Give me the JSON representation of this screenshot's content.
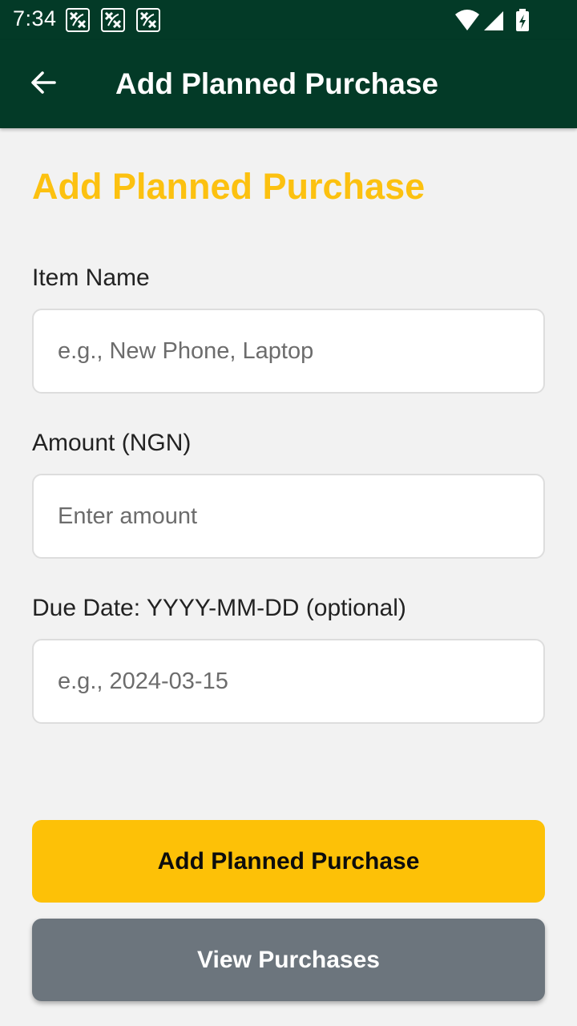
{
  "status_bar": {
    "time": "7:34",
    "notification_icons": [
      "app-notification-icon",
      "app-notification-icon",
      "app-notification-icon"
    ],
    "right_icons": [
      "wifi-icon",
      "cellular-signal-icon",
      "battery-charging-icon"
    ]
  },
  "app_bar": {
    "back_icon": "arrow-left-icon",
    "title": "Add Planned Purchase"
  },
  "page": {
    "heading": "Add Planned Purchase"
  },
  "form": {
    "item_name": {
      "label": "Item Name",
      "value": "",
      "placeholder": "e.g., New Phone, Laptop"
    },
    "amount": {
      "label": "Amount (NGN)",
      "value": "",
      "placeholder": "Enter amount"
    },
    "due_date": {
      "label": "Due Date: YYYY-MM-DD (optional)",
      "value": "",
      "placeholder": "e.g., 2024-03-15"
    }
  },
  "actions": {
    "add_label": "Add Planned Purchase",
    "view_label": "View Purchases"
  },
  "colors": {
    "app_bar": "#033a27",
    "accent_yellow": "#fdc107",
    "heading_yellow": "#fcc110",
    "secondary_gray": "#6c757d",
    "background": "#f2f2f2"
  }
}
